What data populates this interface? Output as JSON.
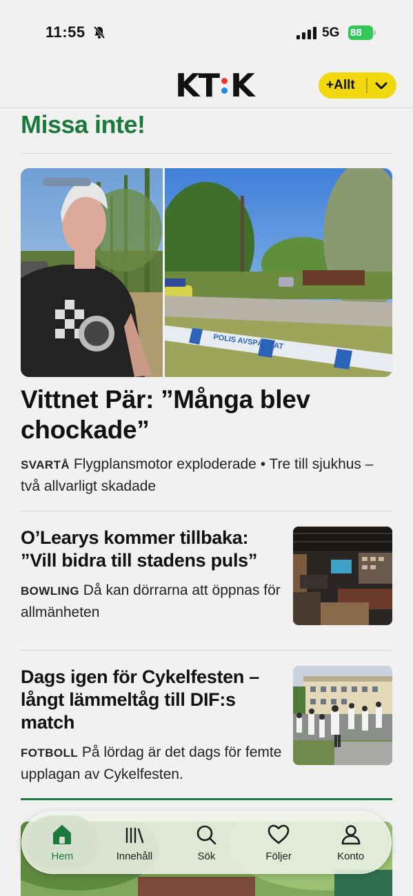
{
  "status_bar": {
    "time": "11:55",
    "network": "5G",
    "battery": "88",
    "icons": [
      "bell-slash-icon",
      "signal-icon",
      "battery-charging-icon"
    ]
  },
  "header": {
    "logo_left": "KT",
    "logo_right": "K",
    "logo_dot_colors": [
      "#e53935",
      "#1e88e5"
    ],
    "filter_label": "+Allt"
  },
  "section": {
    "title": "Missa inte!"
  },
  "articles": [
    {
      "headline": "Vittnet Pär: ”Många blev chockade”",
      "kicker": "SVARTÅ",
      "teaser": "Flygplansmotor exploderade • Tre till sjukhus – två allvarligt skadade",
      "image_text": "POLIS AVSPÄRRAT"
    },
    {
      "headline": "O’Learys kommer tillbaka: ”Vill bidra till stadens puls”",
      "kicker": "BOWLING",
      "teaser": "Då kan dörrarna att öppnas för allmänheten"
    },
    {
      "headline": "Dags igen för Cykelfesten – långt lämmeltåg till DIF:s match",
      "kicker": "FOTBOLL",
      "teaser": "På lördag är det dags för femte upplagan av Cykelfesten."
    }
  ],
  "tab_bar": {
    "tabs": [
      {
        "label": "Hem",
        "icon": "home-icon",
        "active": true
      },
      {
        "label": "Innehåll",
        "icon": "library-icon",
        "active": false
      },
      {
        "label": "Sök",
        "icon": "search-icon",
        "active": false
      },
      {
        "label": "Följer",
        "icon": "heart-icon",
        "active": false
      },
      {
        "label": "Konto",
        "icon": "user-icon",
        "active": false
      }
    ]
  },
  "colors": {
    "accent_green": "#1a7a3c",
    "filter_yellow": "#f2d90f",
    "background": "#f1f1f1",
    "battery_green": "#34c759"
  }
}
